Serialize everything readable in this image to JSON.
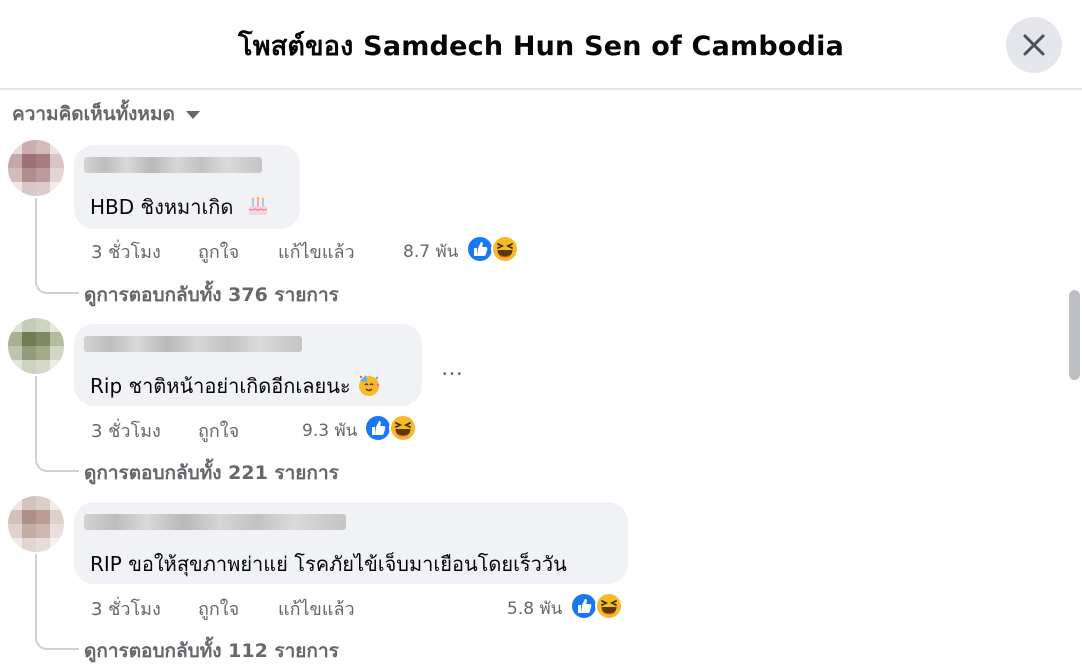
{
  "header": {
    "title": "โพสต์ของ Samdech Hun Sen of Cambodia"
  },
  "filter": {
    "label": "ความคิดเห็นทั้งหมด"
  },
  "comments": [
    {
      "text": "HBD ชิงหมาเกิด",
      "emoji": "birthday-cake",
      "time": "3 ชั่วโมง",
      "like": "ถูกใจ",
      "edited": "แก้ไขแล้ว",
      "reactions": "8.7 พัน",
      "view_replies": "ดูการตอบกลับทั้ง 376 รายการ"
    },
    {
      "text": "Rip ชาติหน้าอย่าเกิดอีกเลยนะ",
      "emoji": "party-face",
      "time": "3 ชั่วโมง",
      "like": "ถูกใจ",
      "reactions": "9.3 พัน",
      "view_replies": "ดูการตอบกลับทั้ง 221 รายการ"
    },
    {
      "text": "RIP ขอให้สุขภาพย่าแย่ โรคภัยไข้เจ็บมาเยือนโดยเร็ววัน",
      "time": "3 ชั่วโมง",
      "like": "ถูกใจ",
      "edited": "แก้ไขแล้ว",
      "reactions": "5.8 พัน",
      "view_replies": "ดูการตอบกลับทั้ง 112 รายการ"
    }
  ],
  "more_options": "…",
  "colors": {
    "like_blue": "#1877f2",
    "haha_yellow": "#f7b928",
    "secondary_text": "#65676b",
    "bubble": "#f0f2f5"
  },
  "icons": [
    "close-icon",
    "caret-down-icon",
    "like-reaction-icon",
    "haha-reaction-icon",
    "cake-emoji-icon",
    "party-emoji-icon"
  ]
}
